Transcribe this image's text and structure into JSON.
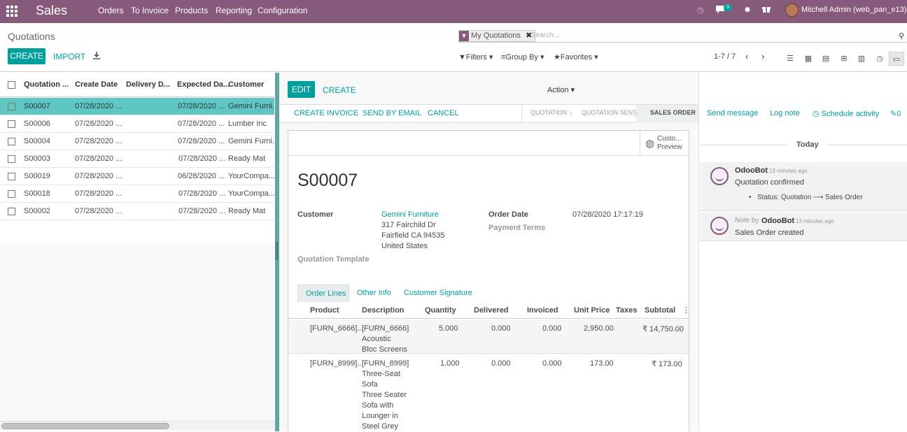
{
  "navbar": {
    "app": "Sales",
    "menus": [
      "Orders",
      "To Invoice",
      "Products",
      "Reporting",
      "Configuration"
    ],
    "chat_count": "3",
    "user": "Mitchell Admin (web_pan_e13)"
  },
  "control_panel": {
    "breadcrumb": "Quotations",
    "create": "CREATE",
    "import": "IMPORT",
    "facet": "My Quotations",
    "search_placeholder": "Search...",
    "filters": "Filters",
    "group_by": "Group By",
    "favorites": "Favorites",
    "pager": "1-7 / 7"
  },
  "list": {
    "columns": [
      "Quotation ...",
      "Create Date",
      "Delivery D...",
      "Expected Da...",
      "Customer"
    ],
    "rows": [
      {
        "number": "S00007",
        "create": "07/28/2020 ...",
        "expected": "07/28/2020 ...",
        "customer": "Gemini Furni..."
      },
      {
        "number": "S00006",
        "create": "07/28/2020 ...",
        "expected": "07/28/2020 ...",
        "customer": "Lumber Inc"
      },
      {
        "number": "S00004",
        "create": "07/28/2020 ...",
        "expected": "07/28/2020 ...",
        "customer": "Gemini Furni..."
      },
      {
        "number": "S00003",
        "create": "07/28/2020 ...",
        "expected": "07/28/2020 ...",
        "customer": "Ready Mat"
      },
      {
        "number": "S00019",
        "create": "07/28/2020 ...",
        "expected": "06/28/2020 ...",
        "customer": "YourCompa..."
      },
      {
        "number": "S00018",
        "create": "07/28/2020 ...",
        "expected": "07/28/2020 ...",
        "customer": "YourCompa..."
      },
      {
        "number": "S00002",
        "create": "07/28/2020 ...",
        "expected": "07/28/2020 ...",
        "customer": "Ready Mat"
      }
    ]
  },
  "form": {
    "edit": "EDIT",
    "create": "CREATE",
    "action": "Action",
    "create_invoice": "CREATE INVOICE",
    "send_email": "SEND BY EMAIL",
    "cancel": "CANCEL",
    "stages": [
      "QUOTATION",
      "QUOTATION SENT",
      "SALES ORDER"
    ],
    "preview_line1": "Custo...",
    "preview_line2": "Preview",
    "name": "S00007",
    "customer_label": "Customer",
    "customer_name": "Gemini Furniture",
    "address": [
      "317 Fairchild Dr",
      "Fairfield CA 94535",
      "United States"
    ],
    "order_date_label": "Order Date",
    "order_date": "07/28/2020 17:17:19",
    "payment_terms_label": "Payment Terms",
    "template_label": "Quotation Template",
    "tabs": [
      "Order Lines",
      "Other Info",
      "Customer Signature"
    ],
    "line_columns": [
      "Product",
      "Description",
      "Quantity",
      "Delivered",
      "Invoiced",
      "Unit Price",
      "Taxes",
      "Subtotal"
    ],
    "lines": [
      {
        "product": "[FURN_6666]...",
        "description": [
          "[FURN_6666]",
          "Acoustic",
          "Bloc Screens"
        ],
        "qty": "5.000",
        "delivered": "0.000",
        "invoiced": "0.000",
        "price": "2,950.00",
        "subtotal": "₹ 14,750.00"
      },
      {
        "product": "[FURN_8999]...",
        "description": [
          "[FURN_8999]",
          "Three-Seat",
          "Sofa",
          "Three Seater",
          "Sofa with",
          "Lounger in",
          "Steel Grey"
        ],
        "qty": "1.000",
        "delivered": "0.000",
        "invoiced": "0.000",
        "price": "173.00",
        "subtotal": "₹ 173.00"
      }
    ]
  },
  "chatter": {
    "send_message": "Send message",
    "log_note": "Log note",
    "schedule": "Schedule activity",
    "followers": "0",
    "today": "Today",
    "m1_author": "OdooBot",
    "m1_time": "- 13 minutes ago",
    "m1_body": "Quotation confirmed",
    "m1_tracking": "Status: Quotation ⟶ Sales Order",
    "m2_prefix": "Note by",
    "m2_author": "OdooBot",
    "m2_time": "- 13 minutes ago",
    "m2_body": "Sales Order created"
  },
  "colors": {
    "brand": "#875a7b",
    "accent": "#00a09d",
    "selected_row": "#5fc6c3"
  }
}
